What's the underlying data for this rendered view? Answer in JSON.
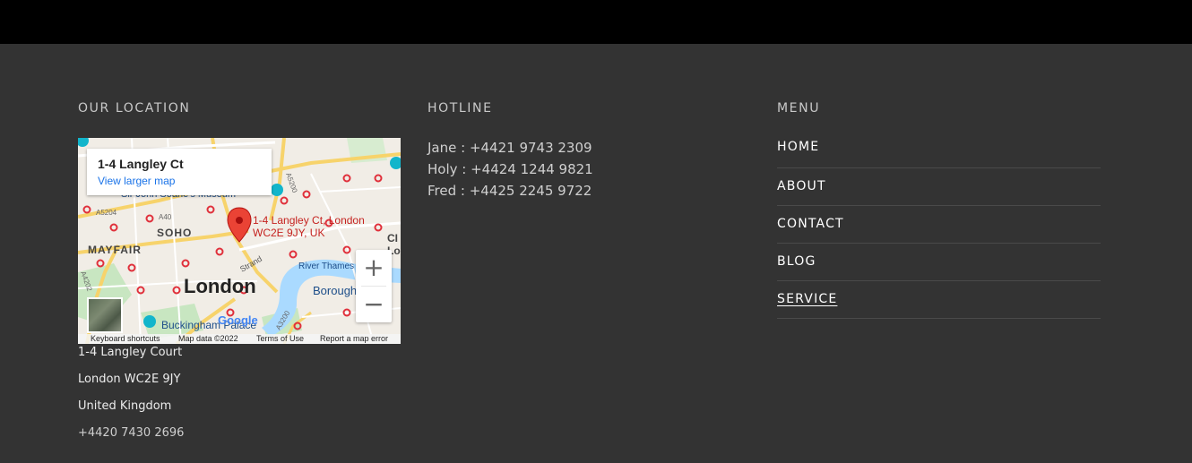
{
  "location": {
    "title": "OUR LOCATION",
    "map": {
      "info_title": "1-4 Langley Ct",
      "info_link": "View larger map",
      "marker_label_line1": "1-4 Langley Ct, London",
      "marker_label_line2": "WC2E 9JY, UK",
      "labels": {
        "soho": "SOHO",
        "mayfair": "MAYFAIR",
        "london": "London",
        "strand": "Strand",
        "river": "River Thames",
        "borough": "Borough",
        "buckingham": "Buckingham Palace",
        "museum": "Sir John Soane's Museum",
        "a40": "A40",
        "a5204": "A5204",
        "a5200": "A5200",
        "a3200": "A3200",
        "a4202": "A4202",
        "cl": "CI",
        "lo": "Lo",
        "google": "Google"
      },
      "zoom_in": "+",
      "zoom_out": "−",
      "attribution": {
        "shortcuts": "Keyboard shortcuts",
        "map_data": "Map data ©2022",
        "terms": "Terms of Use",
        "report": "Report a map error"
      }
    },
    "address_lines": [
      "1-4 Langley Court",
      "London WC2E 9JY",
      "United Kingdom"
    ],
    "phone": "+4420 7430 2696"
  },
  "hotline": {
    "title": "HOTLINE",
    "entries": [
      "Jane : +4421 9743 2309",
      "Holy : +4424 1244 9821",
      "Fred : +4425 2245 9722"
    ]
  },
  "menu": {
    "title": "MENU",
    "items": [
      {
        "label": "HOME"
      },
      {
        "label": "ABOUT"
      },
      {
        "label": "CONTACT"
      },
      {
        "label": "BLOG"
      },
      {
        "label": "SERVICE"
      }
    ]
  },
  "colors": {
    "background": "#333333",
    "topbar": "#000000",
    "link": "#1a73e8",
    "marker": "#ea4335",
    "water": "#aadaff"
  }
}
